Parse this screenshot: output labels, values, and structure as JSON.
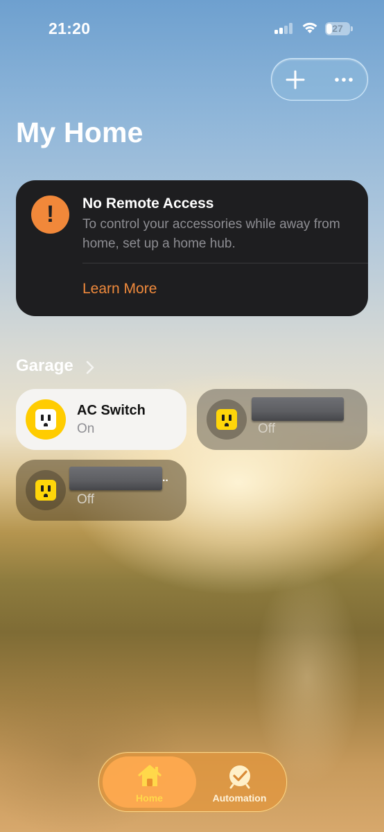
{
  "status_bar": {
    "time": "21:20",
    "battery": "27",
    "battery_level": 0.27,
    "signal_icon": "cellular-signal-icon",
    "wifi_icon": "wifi-icon"
  },
  "toolbar": {
    "add_icon": "plus-icon",
    "more_icon": "ellipsis-icon"
  },
  "page": {
    "title": "My Home"
  },
  "alert": {
    "icon": "exclamation-icon",
    "title": "No Remote Access",
    "body": "To control your accessories while away from home, set up a home hub.",
    "link": "Learn More",
    "accent_color": "#f1883a"
  },
  "section": {
    "title": "Garage",
    "chevron_icon": "chevron-right-icon"
  },
  "accessories": [
    {
      "name": "AC Switch",
      "status": "On",
      "icon": "outlet-icon",
      "state": "on"
    },
    {
      "name": "",
      "status": "Off",
      "icon": "outlet-icon",
      "state": "off",
      "name_redacted": true
    },
    {
      "name": "",
      "status": "Off",
      "icon": "outlet-icon",
      "state": "off",
      "name_redacted": true
    }
  ],
  "tab_bar": {
    "tabs": [
      {
        "label": "Home",
        "icon": "house-icon",
        "selected": true
      },
      {
        "label": "Automation",
        "icon": "clock-checkmark-icon",
        "selected": false
      }
    ],
    "accent_color": "#ffd84a"
  }
}
